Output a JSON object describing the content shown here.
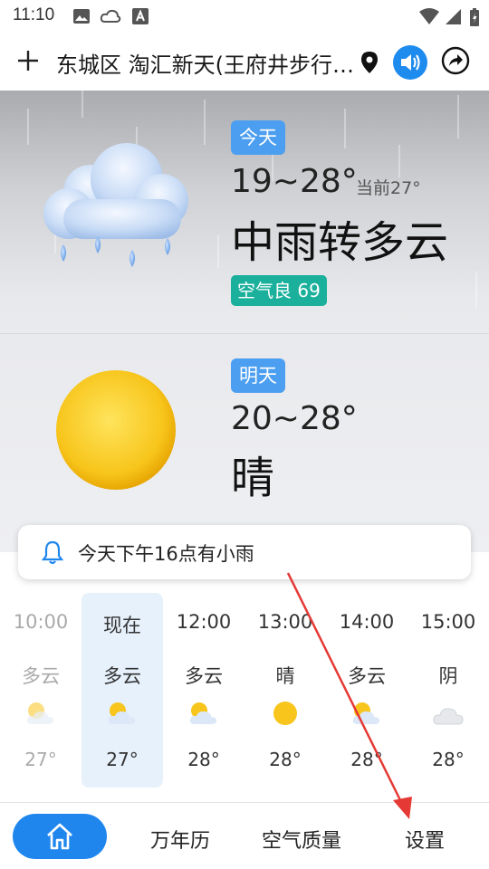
{
  "status_bar": {
    "time": "11:10"
  },
  "header": {
    "location": "东城区 淘汇新天(王府井步行…"
  },
  "today": {
    "badge": "今天",
    "temp_range": "19~28°",
    "current": "当前27°",
    "condition": "中雨转多云",
    "aqi": "空气良 69"
  },
  "tomorrow": {
    "badge": "明天",
    "temp_range": "20~28°",
    "condition": "晴"
  },
  "alert": {
    "text": "今天下午16点有小雨"
  },
  "hourly": [
    {
      "time": "10:00",
      "condition": "多云",
      "icon": "partly-cloudy-icon",
      "temp": "27°"
    },
    {
      "time": "现在",
      "condition": "多云",
      "icon": "partly-cloudy-icon",
      "temp": "27°"
    },
    {
      "time": "12:00",
      "condition": "多云",
      "icon": "partly-cloudy-icon",
      "temp": "28°"
    },
    {
      "time": "13:00",
      "condition": "晴",
      "icon": "sun-icon",
      "temp": "28°"
    },
    {
      "time": "14:00",
      "condition": "多云",
      "icon": "partly-cloudy-icon",
      "temp": "28°"
    },
    {
      "time": "15:00",
      "condition": "阴",
      "icon": "cloud-icon",
      "temp": "28°"
    }
  ],
  "nav": {
    "calendar": "万年历",
    "air_quality": "空气质量",
    "settings": "设置"
  },
  "colors": {
    "accent": "#1f86ee",
    "badge_blue": "#4c9ff0",
    "aqi_green": "#1bb09c",
    "annotation": "#e53935"
  }
}
